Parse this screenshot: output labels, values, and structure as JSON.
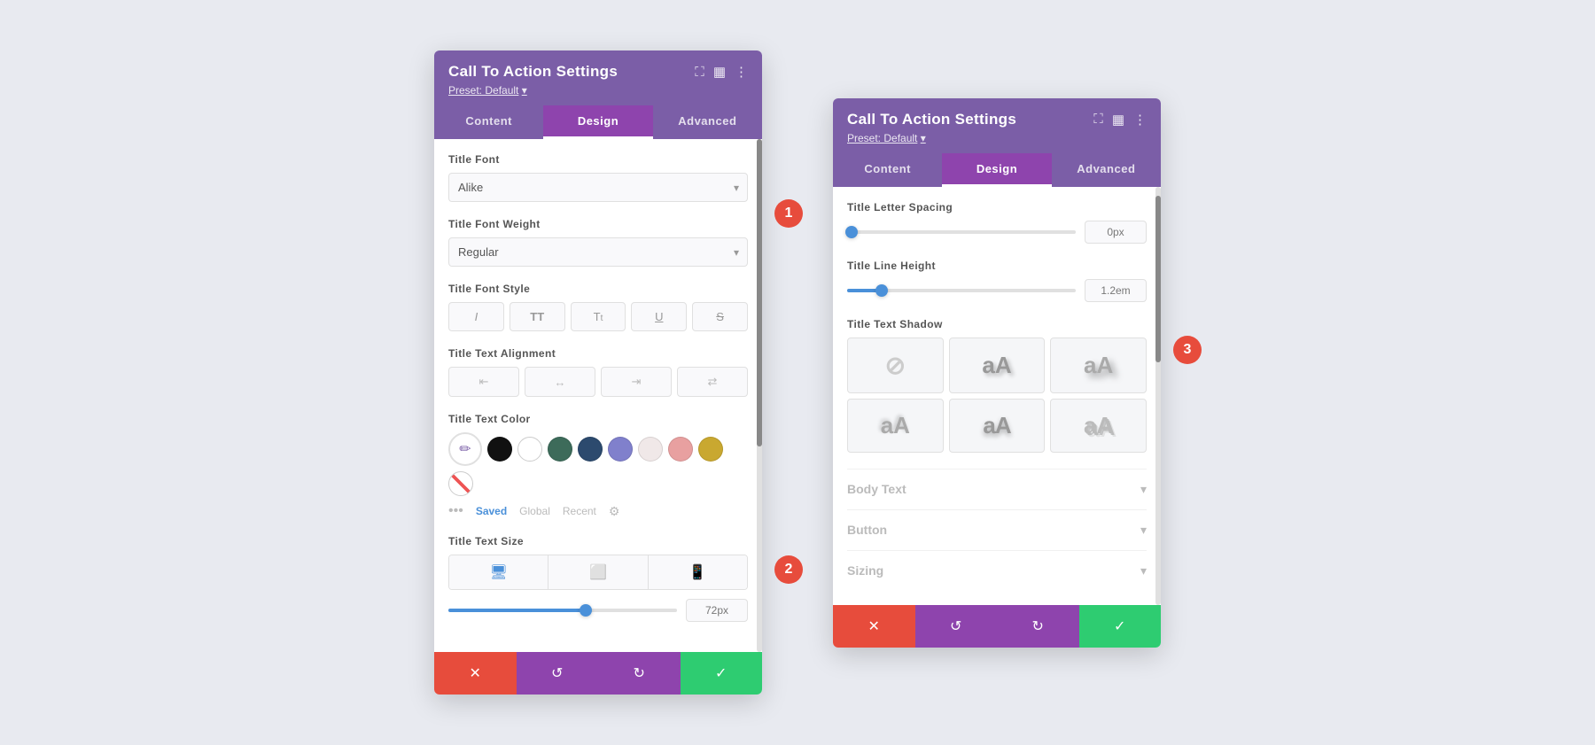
{
  "panel1": {
    "title": "Call To Action Settings",
    "preset": "Preset: Default",
    "preset_arrow": "▾",
    "tabs": [
      "Content",
      "Design",
      "Advanced"
    ],
    "active_tab": "Design",
    "badge1": "1",
    "badge2": "2",
    "fields": {
      "title_font": {
        "label": "Title Font",
        "value": "Alike"
      },
      "title_font_weight": {
        "label": "Title Font Weight",
        "value": "Regular"
      },
      "title_font_style": {
        "label": "Title Font Style",
        "buttons": [
          "I",
          "TT",
          "Tr",
          "U",
          "S"
        ]
      },
      "title_text_alignment": {
        "label": "Title Text Alignment",
        "buttons": [
          "≡",
          "≡",
          "≡",
          "≡"
        ]
      },
      "title_text_color": {
        "label": "Title Text Color",
        "colors": [
          "#111111",
          "#ffffff",
          "#3d6b5a",
          "#2c4a6e",
          "#7b7bcc",
          "#f0e8e8",
          "#e8a0a0",
          "#c9a830",
          "#e55"
        ],
        "tabs": [
          "Saved",
          "Global",
          "Recent"
        ]
      },
      "title_text_size": {
        "label": "Title Text Size",
        "devices": [
          "desktop",
          "tablet",
          "mobile"
        ],
        "slider_value": "72px",
        "slider_percent": 60
      }
    },
    "footer": {
      "cancel": "✕",
      "reset": "↺",
      "redo": "↻",
      "save": "✓"
    }
  },
  "panel2": {
    "title": "Call To Action Settings",
    "preset": "Preset: Default",
    "preset_arrow": "▾",
    "tabs": [
      "Content",
      "Design",
      "Advanced"
    ],
    "active_tab": "Design",
    "badge3": "3",
    "fields": {
      "title_letter_spacing": {
        "label": "Title Letter Spacing",
        "slider_value": "0px",
        "slider_percent": 2
      },
      "title_line_height": {
        "label": "Title Line Height",
        "slider_value": "1.2em",
        "slider_percent": 15
      },
      "title_text_shadow": {
        "label": "Title Text Shadow",
        "options": [
          "none",
          "shadow1",
          "shadow2",
          "shadow3",
          "shadow4",
          "shadow5"
        ]
      }
    },
    "collapsibles": [
      {
        "label": "Body Text",
        "arrow": "▾"
      },
      {
        "label": "Button",
        "arrow": "▾"
      },
      {
        "label": "Sizing",
        "arrow": "▾"
      }
    ],
    "footer": {
      "cancel": "✕",
      "reset": "↺",
      "redo": "↻",
      "save": "✓"
    }
  }
}
